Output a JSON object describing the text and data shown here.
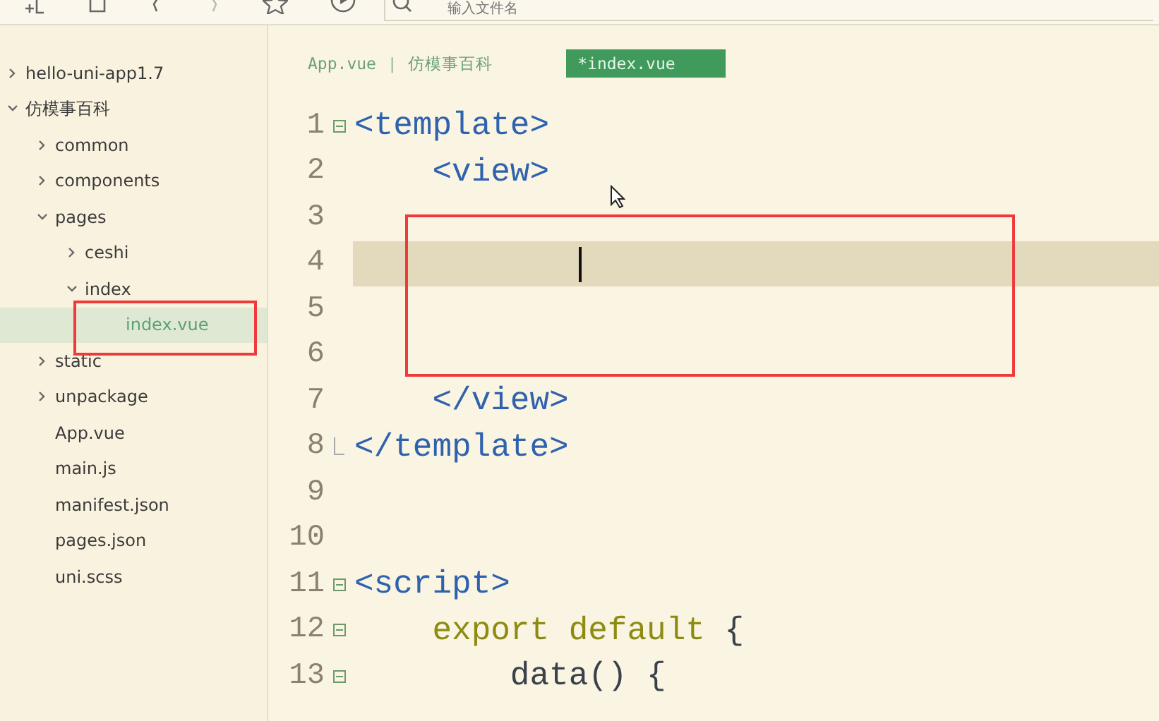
{
  "toolbar": {
    "search": {
      "placeholder": "输入文件名"
    }
  },
  "tree": [
    {
      "label": "hello-uni-app1.7",
      "expanded": false,
      "selected": false
    },
    {
      "label": "仿模事百科",
      "expanded": true,
      "selected": false,
      "children": [
        {
          "label": "common",
          "expanded": false,
          "selected": false
        },
        {
          "label": "components",
          "expanded": false,
          "selected": false
        },
        {
          "label": "pages",
          "expanded": true,
          "selected": false,
          "children": [
            {
              "label": "ceshi",
              "expanded": false,
              "selected": false
            },
            {
              "label": "index",
              "expanded": true,
              "selected": false,
              "children": [
                {
                  "label": "index.vue",
                  "selected": true
                }
              ]
            }
          ]
        },
        {
          "label": "static",
          "expanded": false,
          "selected": false
        },
        {
          "label": "unpackage",
          "expanded": false,
          "selected": false
        },
        {
          "label": "App.vue",
          "selected": false
        },
        {
          "label": "main.js",
          "selected": false
        },
        {
          "label": "manifest.json",
          "selected": false
        },
        {
          "label": "pages.json",
          "selected": false
        },
        {
          "label": "uni.scss",
          "selected": false
        }
      ]
    }
  ],
  "tab_bar": {
    "separator": "|",
    "tabs": [
      {
        "label": "App.vue",
        "selected": false
      },
      {
        "label": "仿模事百科",
        "selected": false
      },
      {
        "label": "*index.vue",
        "selected": true
      }
    ]
  },
  "editor": {
    "lines": [
      {
        "number": "1",
        "collapsible": true,
        "fold_end": false,
        "current": false,
        "tokens": [
          {
            "kind": "tag",
            "text": "<template>"
          }
        ]
      },
      {
        "number": "2",
        "collapsible": false,
        "fold_end": false,
        "current": false,
        "tokens": [
          {
            "kind": "tag",
            "text": "    <view>"
          }
        ]
      },
      {
        "number": "3",
        "collapsible": false,
        "fold_end": false,
        "current": false
      },
      {
        "number": "4",
        "collapsible": false,
        "fold_end": false,
        "current": true
      },
      {
        "number": "5",
        "collapsible": false,
        "fold_end": false,
        "current": false
      },
      {
        "number": "6",
        "collapsible": false,
        "fold_end": false,
        "current": false
      },
      {
        "number": "7",
        "collapsible": false,
        "fold_end": false,
        "current": false,
        "tokens": [
          {
            "kind": "tag",
            "text": "    </view>"
          }
        ]
      },
      {
        "number": "8",
        "collapsible": false,
        "fold_end": true,
        "current": false,
        "tokens": [
          {
            "kind": "tag",
            "text": "</template>"
          }
        ]
      },
      {
        "number": "9",
        "collapsible": false,
        "fold_end": false,
        "current": false
      },
      {
        "number": "10",
        "collapsible": false,
        "fold_end": false,
        "current": false
      },
      {
        "number": "11",
        "collapsible": true,
        "fold_end": false,
        "current": false,
        "tokens": [
          {
            "kind": "tag",
            "text": "<script>"
          }
        ]
      },
      {
        "number": "12",
        "collapsible": true,
        "fold_end": false,
        "current": false,
        "tokens": [
          {
            "kind": "keyword",
            "text": "    export default"
          },
          {
            "kind": "plain",
            "text": " {"
          }
        ]
      },
      {
        "number": "13",
        "collapsible": true,
        "fold_end": false,
        "current": false,
        "tokens": [
          {
            "kind": "plain",
            "text": "        data() {"
          }
        ]
      }
    ]
  }
}
